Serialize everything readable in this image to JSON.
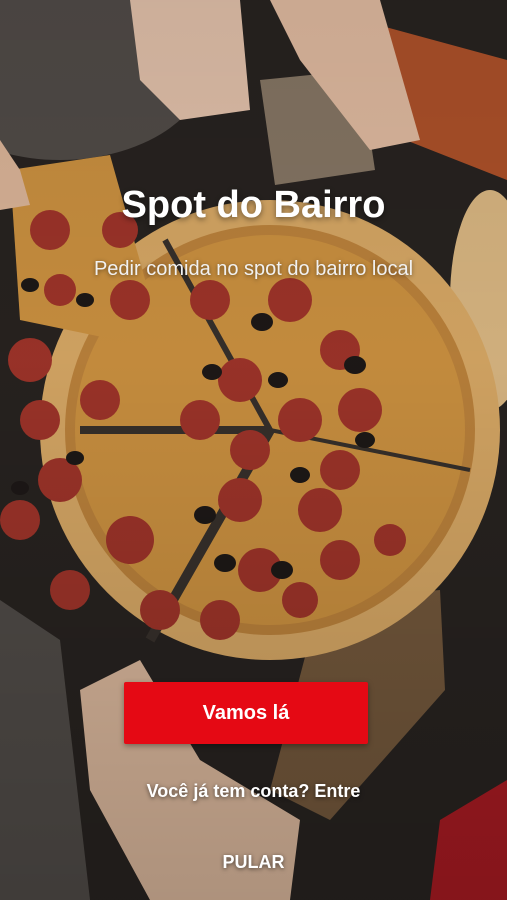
{
  "app": {
    "title": "Spot do Bairro",
    "subtitle": "Pedir comida no spot do bairro local"
  },
  "actions": {
    "primary_label": "Vamos lá",
    "login_label": "Você já tem conta? Entre",
    "skip_label": "PULAR"
  },
  "colors": {
    "primary": "#e50914",
    "text": "#ffffff"
  },
  "background": {
    "image": "pizza-photo"
  }
}
